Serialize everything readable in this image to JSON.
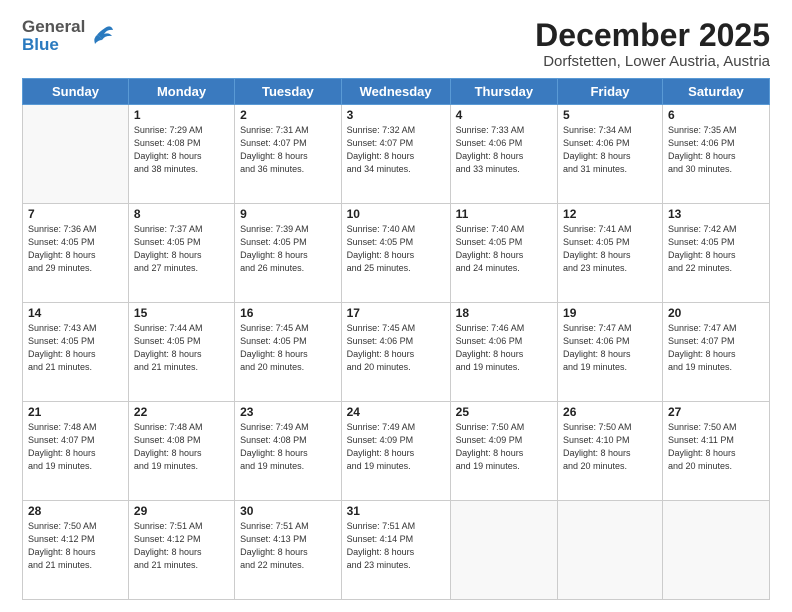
{
  "logo": {
    "general": "General",
    "blue": "Blue"
  },
  "title": "December 2025",
  "location": "Dorfstetten, Lower Austria, Austria",
  "days_header": [
    "Sunday",
    "Monday",
    "Tuesday",
    "Wednesday",
    "Thursday",
    "Friday",
    "Saturday"
  ],
  "weeks": [
    [
      {
        "day": "",
        "info": ""
      },
      {
        "day": "1",
        "info": "Sunrise: 7:29 AM\nSunset: 4:08 PM\nDaylight: 8 hours\nand 38 minutes."
      },
      {
        "day": "2",
        "info": "Sunrise: 7:31 AM\nSunset: 4:07 PM\nDaylight: 8 hours\nand 36 minutes."
      },
      {
        "day": "3",
        "info": "Sunrise: 7:32 AM\nSunset: 4:07 PM\nDaylight: 8 hours\nand 34 minutes."
      },
      {
        "day": "4",
        "info": "Sunrise: 7:33 AM\nSunset: 4:06 PM\nDaylight: 8 hours\nand 33 minutes."
      },
      {
        "day": "5",
        "info": "Sunrise: 7:34 AM\nSunset: 4:06 PM\nDaylight: 8 hours\nand 31 minutes."
      },
      {
        "day": "6",
        "info": "Sunrise: 7:35 AM\nSunset: 4:06 PM\nDaylight: 8 hours\nand 30 minutes."
      }
    ],
    [
      {
        "day": "7",
        "info": "Sunrise: 7:36 AM\nSunset: 4:05 PM\nDaylight: 8 hours\nand 29 minutes."
      },
      {
        "day": "8",
        "info": "Sunrise: 7:37 AM\nSunset: 4:05 PM\nDaylight: 8 hours\nand 27 minutes."
      },
      {
        "day": "9",
        "info": "Sunrise: 7:39 AM\nSunset: 4:05 PM\nDaylight: 8 hours\nand 26 minutes."
      },
      {
        "day": "10",
        "info": "Sunrise: 7:40 AM\nSunset: 4:05 PM\nDaylight: 8 hours\nand 25 minutes."
      },
      {
        "day": "11",
        "info": "Sunrise: 7:40 AM\nSunset: 4:05 PM\nDaylight: 8 hours\nand 24 minutes."
      },
      {
        "day": "12",
        "info": "Sunrise: 7:41 AM\nSunset: 4:05 PM\nDaylight: 8 hours\nand 23 minutes."
      },
      {
        "day": "13",
        "info": "Sunrise: 7:42 AM\nSunset: 4:05 PM\nDaylight: 8 hours\nand 22 minutes."
      }
    ],
    [
      {
        "day": "14",
        "info": "Sunrise: 7:43 AM\nSunset: 4:05 PM\nDaylight: 8 hours\nand 21 minutes."
      },
      {
        "day": "15",
        "info": "Sunrise: 7:44 AM\nSunset: 4:05 PM\nDaylight: 8 hours\nand 21 minutes."
      },
      {
        "day": "16",
        "info": "Sunrise: 7:45 AM\nSunset: 4:05 PM\nDaylight: 8 hours\nand 20 minutes."
      },
      {
        "day": "17",
        "info": "Sunrise: 7:45 AM\nSunset: 4:06 PM\nDaylight: 8 hours\nand 20 minutes."
      },
      {
        "day": "18",
        "info": "Sunrise: 7:46 AM\nSunset: 4:06 PM\nDaylight: 8 hours\nand 19 minutes."
      },
      {
        "day": "19",
        "info": "Sunrise: 7:47 AM\nSunset: 4:06 PM\nDaylight: 8 hours\nand 19 minutes."
      },
      {
        "day": "20",
        "info": "Sunrise: 7:47 AM\nSunset: 4:07 PM\nDaylight: 8 hours\nand 19 minutes."
      }
    ],
    [
      {
        "day": "21",
        "info": "Sunrise: 7:48 AM\nSunset: 4:07 PM\nDaylight: 8 hours\nand 19 minutes."
      },
      {
        "day": "22",
        "info": "Sunrise: 7:48 AM\nSunset: 4:08 PM\nDaylight: 8 hours\nand 19 minutes."
      },
      {
        "day": "23",
        "info": "Sunrise: 7:49 AM\nSunset: 4:08 PM\nDaylight: 8 hours\nand 19 minutes."
      },
      {
        "day": "24",
        "info": "Sunrise: 7:49 AM\nSunset: 4:09 PM\nDaylight: 8 hours\nand 19 minutes."
      },
      {
        "day": "25",
        "info": "Sunrise: 7:50 AM\nSunset: 4:09 PM\nDaylight: 8 hours\nand 19 minutes."
      },
      {
        "day": "26",
        "info": "Sunrise: 7:50 AM\nSunset: 4:10 PM\nDaylight: 8 hours\nand 20 minutes."
      },
      {
        "day": "27",
        "info": "Sunrise: 7:50 AM\nSunset: 4:11 PM\nDaylight: 8 hours\nand 20 minutes."
      }
    ],
    [
      {
        "day": "28",
        "info": "Sunrise: 7:50 AM\nSunset: 4:12 PM\nDaylight: 8 hours\nand 21 minutes."
      },
      {
        "day": "29",
        "info": "Sunrise: 7:51 AM\nSunset: 4:12 PM\nDaylight: 8 hours\nand 21 minutes."
      },
      {
        "day": "30",
        "info": "Sunrise: 7:51 AM\nSunset: 4:13 PM\nDaylight: 8 hours\nand 22 minutes."
      },
      {
        "day": "31",
        "info": "Sunrise: 7:51 AM\nSunset: 4:14 PM\nDaylight: 8 hours\nand 23 minutes."
      },
      {
        "day": "",
        "info": ""
      },
      {
        "day": "",
        "info": ""
      },
      {
        "day": "",
        "info": ""
      }
    ]
  ]
}
